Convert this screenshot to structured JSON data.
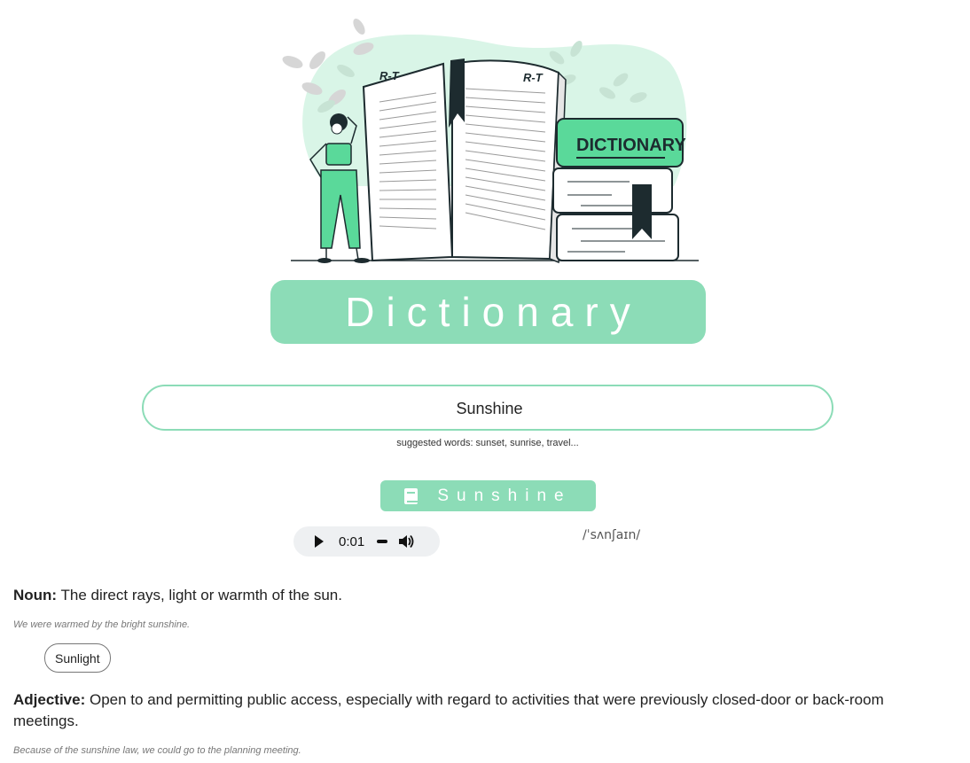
{
  "app": {
    "title": "Dictionary"
  },
  "hero": {
    "book_left_label": "R-T",
    "book_right_label": "R-T",
    "cover_label": "DICTIONARY"
  },
  "search": {
    "value": "Sunshine"
  },
  "suggestions": {
    "text": "suggested words: sunset, sunrise, travel..."
  },
  "word": {
    "title": "Sunshine",
    "icon": "book-icon"
  },
  "audio": {
    "time": "0:01"
  },
  "phonetic": "/ˈsʌnʃaɪn/",
  "definitions": [
    {
      "pos": "Noun:",
      "text": "The direct rays, light or warmth of the sun.",
      "example": "We were warmed by the bright sunshine.",
      "synonyms": [
        "Sunlight"
      ]
    },
    {
      "pos": "Adjective:",
      "text": "Open to and permitting public access, especially with regard to activities that were previously closed-door or back-room meetings.",
      "example": "Because of the sunshine law, we could go to the planning meeting."
    }
  ],
  "colors": {
    "accent": "#8cdcb7",
    "dark": "#1d2b2f",
    "green": "#5ad99a"
  }
}
